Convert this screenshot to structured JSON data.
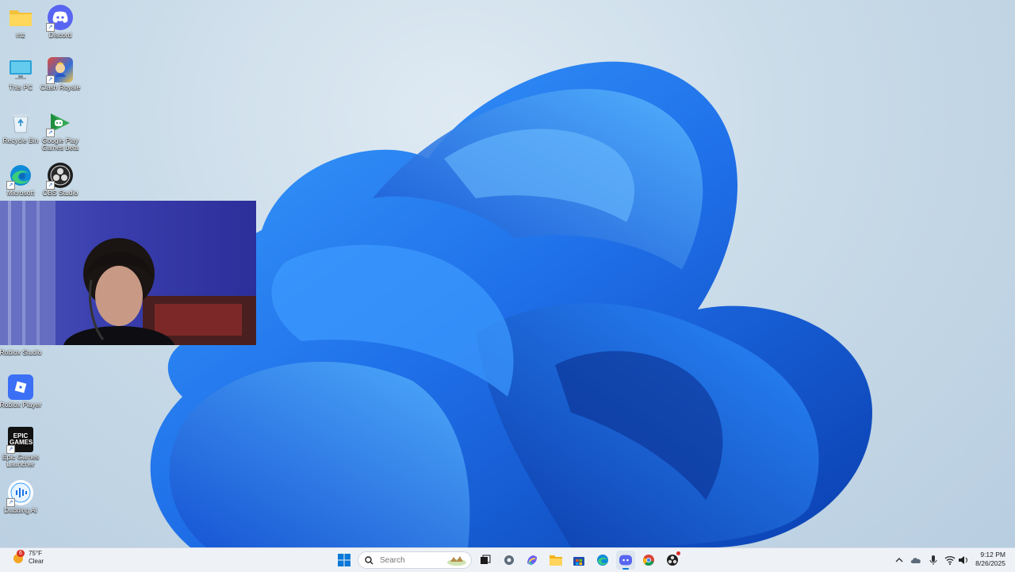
{
  "desktop": {
    "icons": [
      {
        "label": "mz",
        "icon": "folder-icon"
      },
      {
        "label": "Discord",
        "icon": "discord-icon"
      },
      {
        "label": "This PC",
        "icon": "monitor-icon"
      },
      {
        "label": "Clash Royale",
        "icon": "clash-royale-icon"
      },
      {
        "label": "Recycle Bin",
        "icon": "recycle-bin-icon"
      },
      {
        "label": "Google Play Games beta",
        "icon": "google-play-games-icon"
      },
      {
        "label": "Microsoft",
        "icon": "edge-icon"
      },
      {
        "label": "OBS Studio",
        "icon": "obs-icon"
      },
      {
        "label": "Roblox Studio",
        "icon": "roblox-studio-icon"
      },
      {
        "label": "Roblox Player",
        "icon": "roblox-player-icon"
      },
      {
        "label": "Epic Games Launcher",
        "icon": "epic-games-icon"
      },
      {
        "label": "Dubbing AI",
        "icon": "dubbing-ai-icon"
      }
    ],
    "epic_logo_text": "EPIC GAMES"
  },
  "taskbar": {
    "weather": {
      "temp": "75°F",
      "condition": "Clear",
      "badge": "6"
    },
    "search": {
      "placeholder": "Search"
    },
    "pinned": [
      "start-icon",
      "task-view-icon",
      "settings-icon",
      "copilot-icon",
      "file-explorer-icon",
      "store-icon",
      "edge-icon",
      "discord-icon",
      "chrome-icon",
      "obs-icon"
    ],
    "clock": {
      "time": "9:12 PM",
      "date": "8/26/2025"
    }
  },
  "colors": {
    "accent": "#1a73e8",
    "taskbar_bg": "#eef2f7",
    "discord": "#5865f2"
  }
}
